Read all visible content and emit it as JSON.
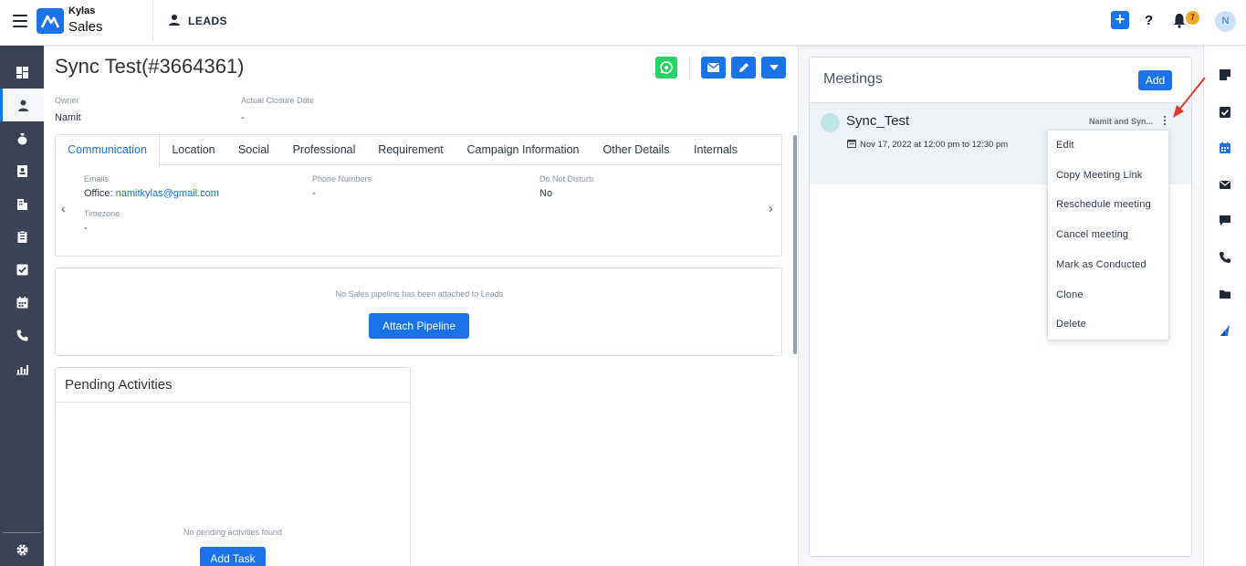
{
  "app": {
    "logo_top": "Kylas",
    "logo_bottom": "Sales",
    "module": "LEADS",
    "notifications": "7",
    "avatar_initial": "N"
  },
  "lead": {
    "title": "Sync Test(#3664361)",
    "owner_label": "Owner",
    "owner_value": "Namit",
    "closure_label": "Actual Closure Date",
    "closure_value": "-"
  },
  "tabs": [
    "Communication",
    "Location",
    "Social",
    "Professional",
    "Requirement",
    "Campaign Information",
    "Other Details",
    "Internals"
  ],
  "communication": {
    "emails_label": "Emails",
    "email_prefix": "Office:",
    "email_value": "namitkylas@gmail.com",
    "phone_label": "Phone Numbers",
    "phone_value": "-",
    "dnd_label": "Do Not Disturb",
    "dnd_value": "No",
    "timezone_label": "Timezone",
    "timezone_value": "-"
  },
  "pipeline": {
    "message": "No Sales pipeline has been attached to Leads",
    "button": "Attach Pipeline"
  },
  "pending": {
    "title": "Pending Activities",
    "message": "No pending activities found",
    "button": "Add Task"
  },
  "meetings": {
    "title": "Meetings",
    "add_label": "Add",
    "item": {
      "name": "Sync_Test",
      "time": "Nov 17, 2022 at 12:00 pm to 12:30 pm",
      "owner": "Namit and Syn..."
    },
    "menu": [
      "Edit",
      "Copy Meeting Link",
      "Reschedule meeting",
      "Cancel meeting",
      "Mark as Conducted",
      "Clone",
      "Delete"
    ]
  },
  "colors": {
    "accent": "#1a73e8",
    "sidebar": "#3b4457",
    "whatsapp": "#25d366",
    "badge": "#f5a623",
    "annotation": "#e53935"
  }
}
